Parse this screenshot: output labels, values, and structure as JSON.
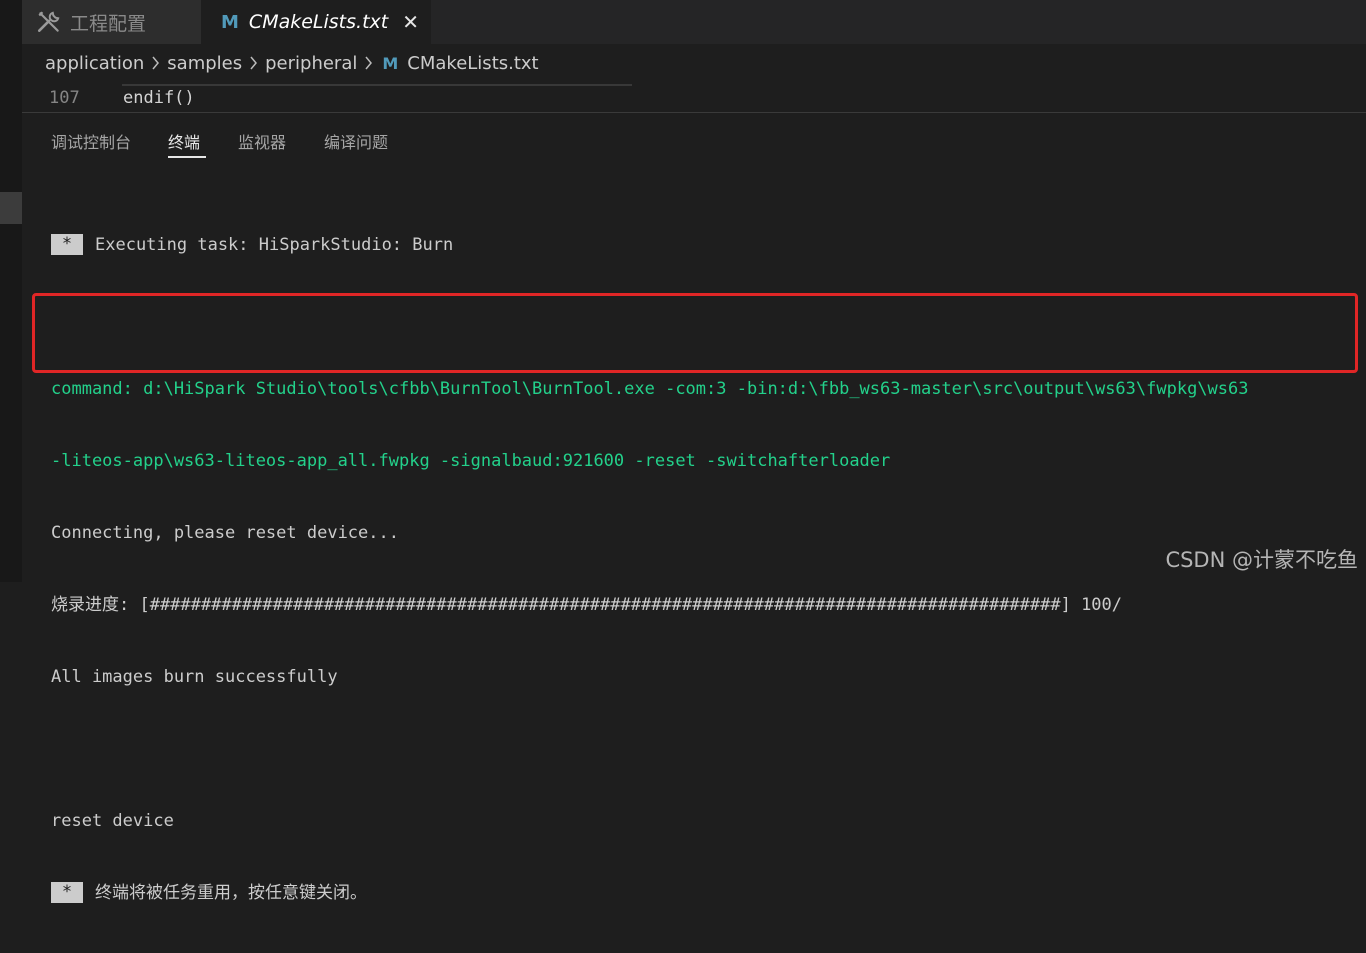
{
  "tabs": [
    {
      "label": "工程配置",
      "icon": "tools-icon",
      "active": false
    },
    {
      "label": "CMakeLists.txt",
      "icon": "m-file-icon",
      "icon_glyph": "M",
      "close_glyph": "✕",
      "active": true
    }
  ],
  "breadcrumb": {
    "items": [
      "application",
      "samples",
      "peripheral"
    ],
    "file": "CMakeLists.txt",
    "file_icon_glyph": "M"
  },
  "editor": {
    "line_number": "107",
    "code": "endif()"
  },
  "panel": {
    "tabs": [
      "调试控制台",
      "终端",
      "监视器",
      "编译问题"
    ],
    "active_tab": "终端"
  },
  "terminal": {
    "star_glyph": "*",
    "executing": "Executing task: HiSparkStudio: Burn",
    "command_line1": "command: d:\\HiSpark Studio\\tools\\cfbb\\BurnTool\\BurnTool.exe -com:3 -bin:d:\\fbb_ws63-master\\src\\output\\ws63\\fwpkg\\ws63",
    "command_line2": "-liteos-app\\ws63-liteos-app_all.fwpkg -signalbaud:921600 -reset -switchafterloader",
    "connecting": "Connecting, please reset device...",
    "progress": "烧录进度: [#########################################################################################] 100/",
    "success": "All images burn successfully",
    "reset": "reset device",
    "reuse": "终端将被任务重用，按任意键关闭。"
  },
  "watermark": "CSDN @计蒙不吃鱼",
  "colors": {
    "background": "#1e1e1e",
    "command_text": "#23d18b",
    "highlight_border": "#e02626",
    "m_icon": "#519aba"
  }
}
